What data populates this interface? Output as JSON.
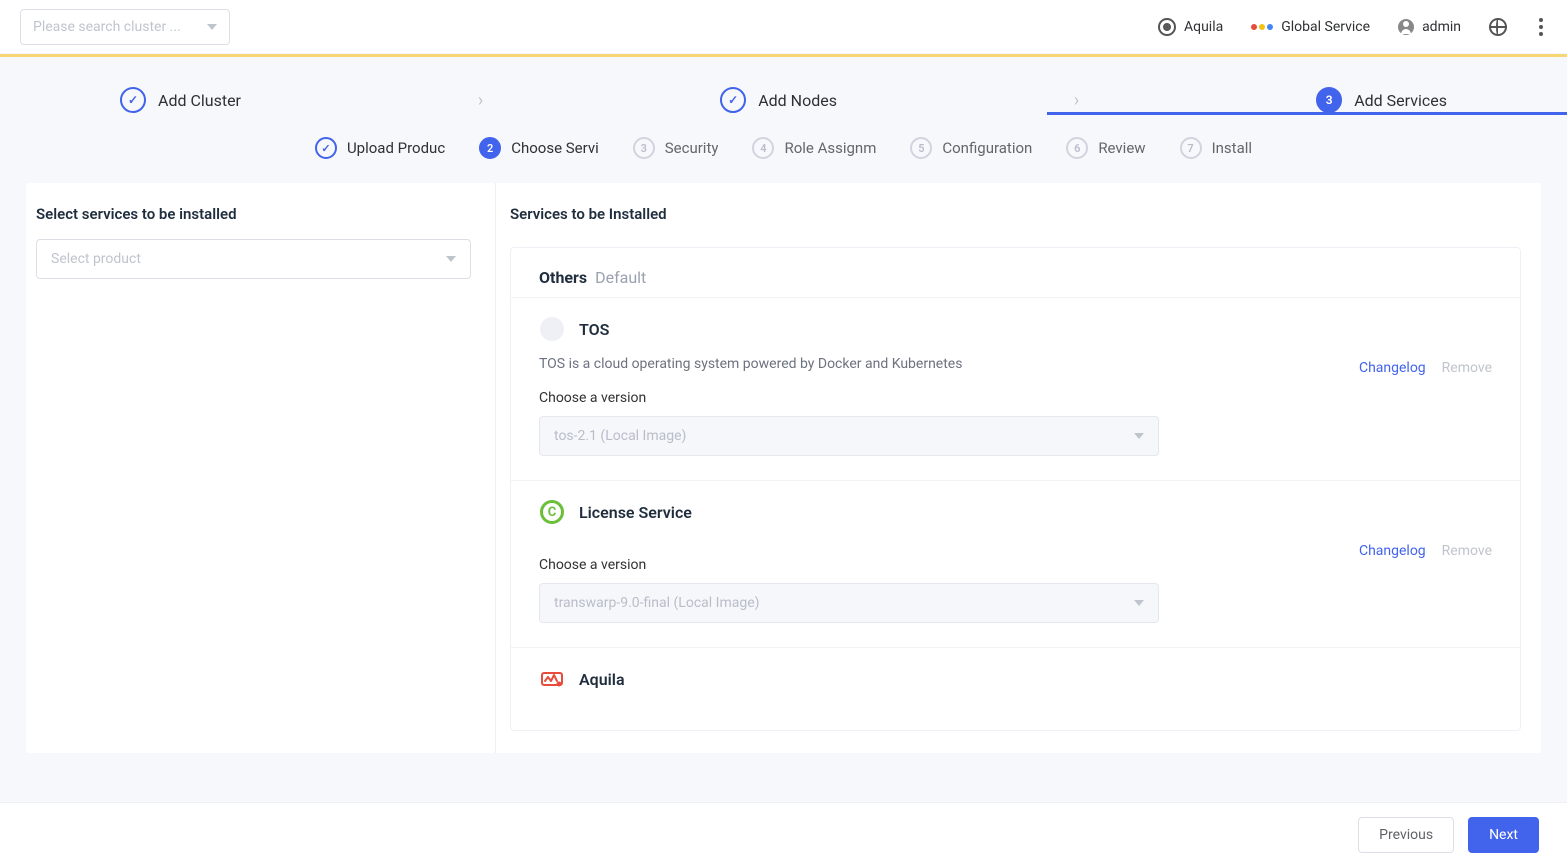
{
  "topbar": {
    "search_placeholder": "Please search cluster ...",
    "items": {
      "aquila": "Aquila",
      "global_service": "Global Service",
      "admin": "admin"
    }
  },
  "main_steps": {
    "s1": "Add Cluster",
    "s2": "Add Nodes",
    "s3": "Add Services",
    "s3_num": "3"
  },
  "sub_steps": {
    "s1": "Upload Produc",
    "s2_num": "2",
    "s2": "Choose Servi",
    "s3_num": "3",
    "s3": "Security",
    "s4_num": "4",
    "s4": "Role Assignm",
    "s5_num": "5",
    "s5": "Configuration",
    "s6_num": "6",
    "s6": "Review",
    "s7_num": "7",
    "s7": "Install"
  },
  "left": {
    "heading": "Select services to be installed",
    "product_placeholder": "Select product"
  },
  "right": {
    "heading": "Services to be Installed",
    "group_main": "Others",
    "group_sub": "Default",
    "services": {
      "tos": {
        "name": "TOS",
        "desc": "TOS is a cloud operating system powered by Docker and Kubernetes",
        "choose_label": "Choose a version",
        "version": "tos-2.1 (Local Image)",
        "changelog": "Changelog",
        "remove": "Remove"
      },
      "license": {
        "name": "License Service",
        "choose_label": "Choose a version",
        "version": "transwarp-9.0-final (Local Image)",
        "changelog": "Changelog",
        "remove": "Remove"
      },
      "aquila": {
        "name": "Aquila"
      }
    }
  },
  "footer": {
    "previous": "Previous",
    "next": "Next"
  }
}
